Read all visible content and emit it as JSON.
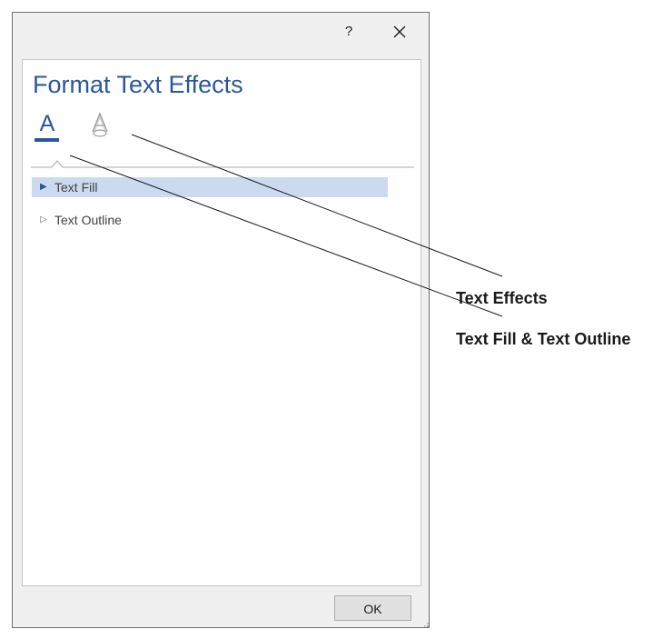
{
  "dialog": {
    "help_label": "?",
    "ok_label": "OK"
  },
  "pane": {
    "title": "Format Text Effects",
    "tabs": [
      {
        "id": "text-fill-outline",
        "glyph": "A",
        "selected": true
      },
      {
        "id": "text-effects",
        "glyph": "A",
        "selected": false
      }
    ],
    "sections": [
      {
        "label": "Text Fill",
        "expanded_arrow": "▶",
        "highlighted": true
      },
      {
        "label": "Text Outline",
        "expanded_arrow": "▷",
        "highlighted": false
      }
    ]
  },
  "callouts": {
    "text_effects": "Text Effects",
    "text_fill_outline": "Text Fill & Text Outline"
  },
  "colors": {
    "accent": "#2b579a",
    "highlight": "#ccdaf0",
    "dialog_bg": "#f0f0f0"
  },
  "icons": {
    "close": "close-icon",
    "help": "help-icon",
    "text_fill_tab": "text-fill-outline-icon",
    "text_effects_tab": "text-effects-icon",
    "expanded_arrow": "triangle-right-filled-icon",
    "collapsed_arrow": "triangle-right-outline-icon"
  }
}
